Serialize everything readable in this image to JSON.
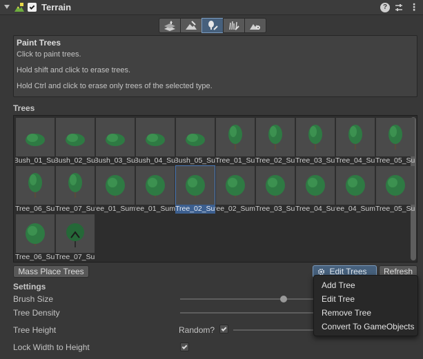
{
  "header": {
    "title": "Terrain",
    "enabled": true,
    "icons": [
      "terrain-icon",
      "help-icon",
      "settings-sliders-icon",
      "more-menu-icon"
    ]
  },
  "toolbar": {
    "tools": [
      {
        "name": "create-neighbor-terrains",
        "icon": "raise-terrain-icon"
      },
      {
        "name": "sculpt-terrain",
        "icon": "sculpt-brush-icon"
      },
      {
        "name": "paint-trees",
        "icon": "paint-tree-icon",
        "active": true
      },
      {
        "name": "paint-details",
        "icon": "paint-details-icon"
      },
      {
        "name": "terrain-settings",
        "icon": "terrain-settings-icon"
      }
    ]
  },
  "help": {
    "title": "Paint Trees",
    "line1": "Click to paint trees.",
    "line2": "Hold shift and click to erase trees.",
    "line3": "Hold Ctrl and click to erase only trees of the selected type."
  },
  "trees": {
    "label": "Trees",
    "items": [
      {
        "label": "Bush_01_Su",
        "kind": "bush"
      },
      {
        "label": "Bush_02_Su",
        "kind": "bush"
      },
      {
        "label": "Bush_03_Su",
        "kind": "bush"
      },
      {
        "label": "Bush_04_Su",
        "kind": "bush"
      },
      {
        "label": "Bush_05_Su",
        "kind": "bush"
      },
      {
        "label": "Tree_01_Su",
        "kind": "tall"
      },
      {
        "label": "Tree_02_Su",
        "kind": "tall"
      },
      {
        "label": "Tree_03_Su",
        "kind": "tall"
      },
      {
        "label": "Tree_04_Su",
        "kind": "tall"
      },
      {
        "label": "Tree_05_Su",
        "kind": "tall"
      },
      {
        "label": "Tree_06_Su",
        "kind": "tall"
      },
      {
        "label": "Tree_07_Su",
        "kind": "tall"
      },
      {
        "label": "Tree_01_Sum",
        "kind": "round"
      },
      {
        "label": "ree_01_Sum",
        "kind": "round"
      },
      {
        "label": "Tree_02_Su",
        "kind": "round",
        "selected": true
      },
      {
        "label": "ree_02_Sum",
        "kind": "round"
      },
      {
        "label": "Tree_03_Su",
        "kind": "round"
      },
      {
        "label": "Tree_04_Su",
        "kind": "round"
      },
      {
        "label": "ree_04_Sum",
        "kind": "round"
      },
      {
        "label": "Tree_05_Su",
        "kind": "round"
      },
      {
        "label": "Tree_06_Su",
        "kind": "round"
      },
      {
        "label": "Tree_07_Su",
        "kind": "dark"
      }
    ]
  },
  "buttons": {
    "mass_place": "Mass Place Trees",
    "edit_trees": "Edit Trees",
    "refresh": "Refresh"
  },
  "settings": {
    "label": "Settings",
    "brush_size": "Brush Size",
    "brush_size_value": 0.77,
    "tree_density": "Tree Density",
    "tree_height": "Tree Height",
    "random_label": "Random?",
    "random_checked": true,
    "lock_width": "Lock Width to Height",
    "lock_width_checked": true
  },
  "popup_menu": {
    "items": [
      "Add Tree",
      "Edit Tree",
      "Remove Tree",
      "Convert To GameObjects"
    ]
  },
  "colors": {
    "background": "#383838",
    "accent": "#46607c",
    "selection": "#3c5f8f",
    "foliage": "#2e7a43"
  }
}
